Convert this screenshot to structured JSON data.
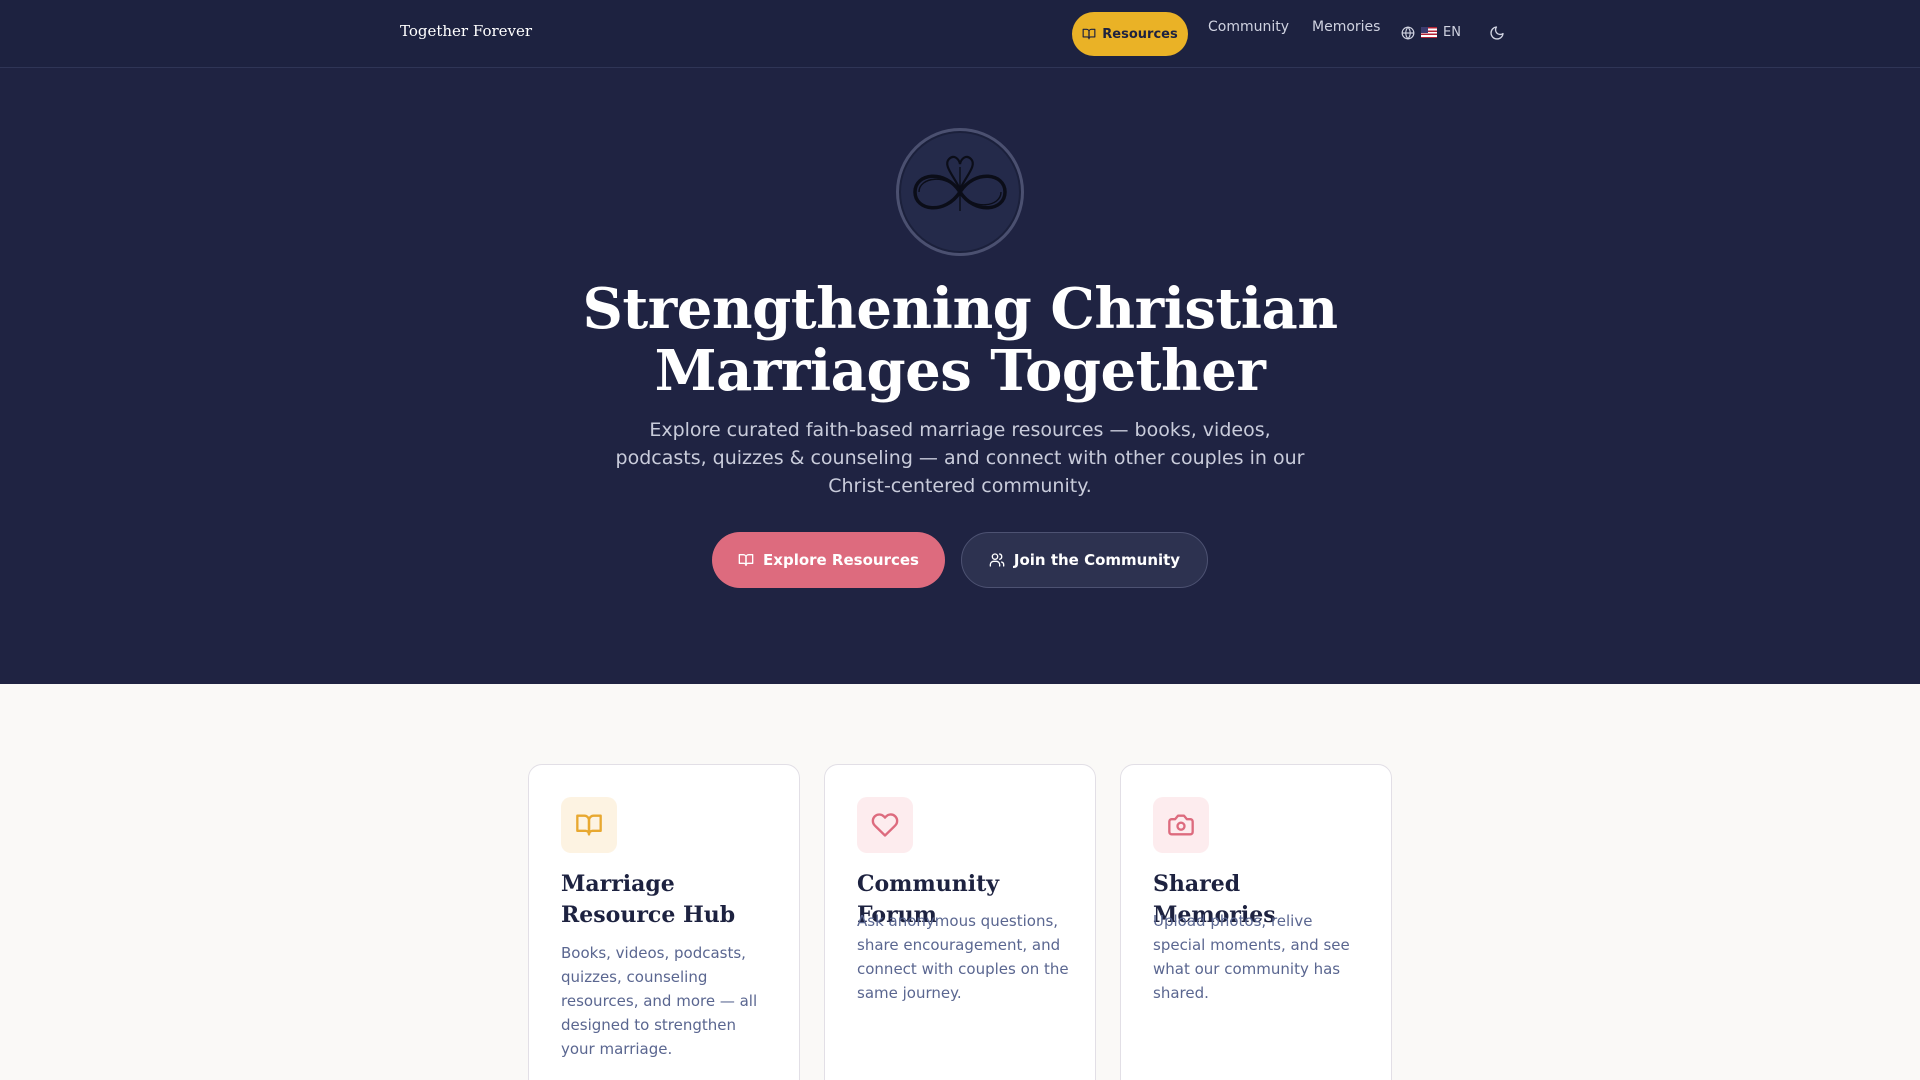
{
  "nav": {
    "brand": "Together Forever",
    "items": [
      {
        "label": "Resources",
        "icon": "book-open-icon",
        "active": true
      },
      {
        "label": "Community"
      },
      {
        "label": "Memories"
      }
    ],
    "language": {
      "flag": "🇺🇸",
      "label": "EN",
      "icon": "globe-icon"
    },
    "theme_toggle_icon": "moon-icon"
  },
  "hero": {
    "title": "Strengthening Christian Marriages Together",
    "subtitle": "Explore curated faith-based marriage resources — books, videos, podcasts, quizzes & counseling — and connect with other couples in our Christ-centered community.",
    "primary_cta": {
      "label": "Explore Resources",
      "icon": "book-open-icon"
    },
    "secondary_cta": {
      "label": "Join the Community",
      "icon": "users-icon"
    }
  },
  "features": [
    {
      "title": "Marriage Resource Hub",
      "description": "Books, videos, podcasts, quizzes, counseling resources, and more — all designed to strengthen your marriage.",
      "icon": "book-open-icon",
      "icon_color": "#e8a830",
      "icon_bg": "#fdf3e2"
    },
    {
      "title": "Community Forum",
      "description": "Ask anonymous questions, share encouragement, and connect with couples on the same journey.",
      "icon": "heart-icon",
      "icon_color": "#dd6b7e",
      "icon_bg": "#fdecee"
    },
    {
      "title": "Shared Memories",
      "description": "Upload photos, relive special moments, and see what our community has shared.",
      "icon": "camera-icon",
      "icon_color": "#dd6b7e",
      "icon_bg": "#fdecee"
    }
  ],
  "colors": {
    "navy": "#1f2342",
    "gold": "#eab226",
    "rose": "#dd6b7e"
  }
}
